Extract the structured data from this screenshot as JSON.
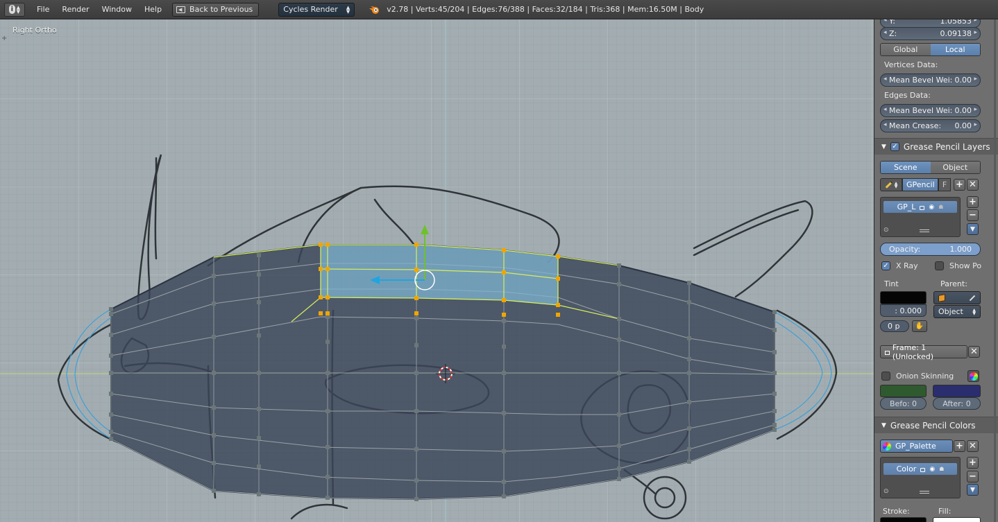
{
  "header": {
    "editor_icon": "info-icon",
    "menus": [
      "File",
      "Render",
      "Window",
      "Help"
    ],
    "back_label": "Back to Previous",
    "engine": "Cycles Render",
    "stats": "v2.78 | Verts:45/204 | Edges:76/388 | Faces:32/184 | Tris:368 | Mem:16.50M | Body"
  },
  "viewport": {
    "view_label": "Right Ortho",
    "colors": {
      "background": "#a3adb1",
      "mesh_face": "#3a4658",
      "selected_face": "#7fb4d0",
      "vertex": "#6b7778",
      "selected_vertex": "#f0a500",
      "wire": "#9aa3a8",
      "sketch_line": "#2f3438",
      "y_axis": "#6ec12b",
      "z_axis": "#1fa5e0"
    }
  },
  "panel": {
    "y_label": "Y:",
    "y_value": "1.05853",
    "z_label": "Z:",
    "z_value": "0.09138",
    "global_label": "Global",
    "local_label": "Local",
    "vertices_data_label": "Vertices Data:",
    "vert_bevel_label": "Mean Bevel Wei:",
    "vert_bevel_value": "0.00",
    "edges_data_label": "Edges Data:",
    "edge_bevel_label": "Mean Bevel Wei:",
    "edge_bevel_value": "0.00",
    "crease_label": "Mean Crease:",
    "crease_value": "0.00",
    "gp_layers_title": "Grease Pencil Layers",
    "scene_label": "Scene",
    "object_label": "Object",
    "gpencil_name": "GPencil",
    "f_label": "F",
    "layer_name": "GP_L",
    "opacity_label": "Opacity:",
    "opacity_value": "1.000",
    "opacity_fraction": 1.0,
    "xray_label": "X Ray",
    "show_points_label": "Show Po",
    "tint_label": "Tint",
    "parent_label": "Parent:",
    "tint_value": ": 0.000",
    "thickness_value": "0 p",
    "parent_type": "Object",
    "frame_label": "Frame: 1 (Unlocked)",
    "onion_label": "Onion Skinning",
    "before_label": "Befo: 0",
    "after_label": "After: 0",
    "gp_colors_title": "Grease Pencil Colors",
    "palette_name": "GP_Palette",
    "color_name": "Color",
    "stroke_label": "Stroke:",
    "fill_label": "Fill:",
    "onion_before_color": "#2f5a2f",
    "onion_after_color": "#2a2d6e"
  }
}
